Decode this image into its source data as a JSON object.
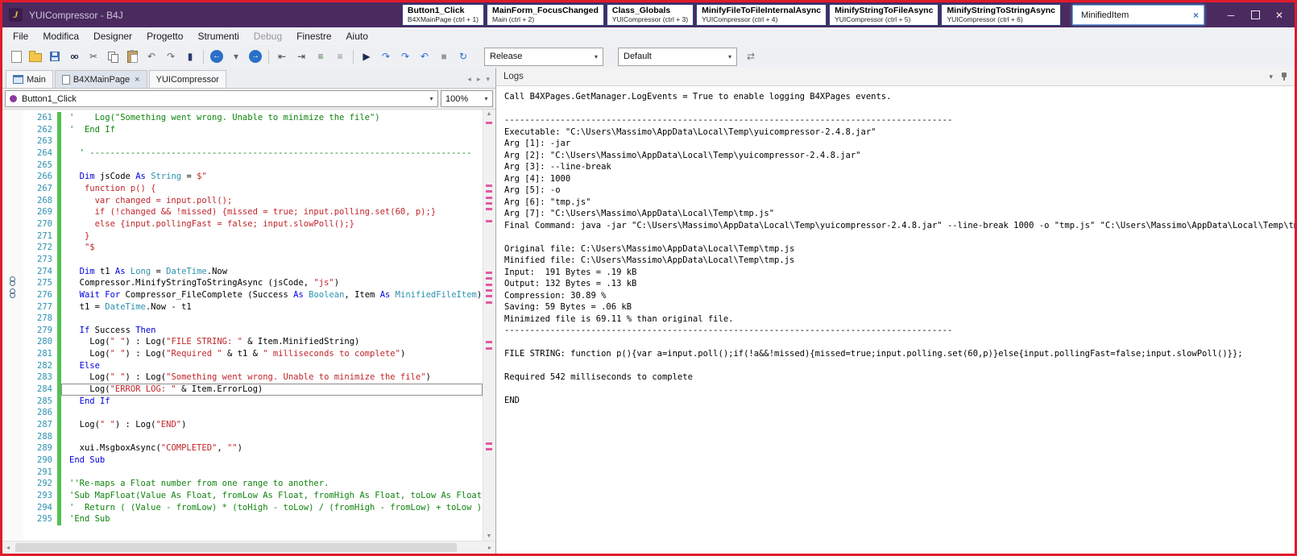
{
  "window": {
    "title": "YUICompressor - B4J",
    "logo": "J",
    "search": {
      "value": "MinifiedItem",
      "clear": "×"
    }
  },
  "quick_tabs": [
    {
      "title": "Button1_Click",
      "subtitle": "B4XMainPage (ctrl + 1)"
    },
    {
      "title": "MainForm_FocusChanged",
      "subtitle": "Main (ctrl + 2)"
    },
    {
      "title": "Class_Globals",
      "subtitle": "YUICompressor (ctrl + 3)"
    },
    {
      "title": "MinifyFileToFileInternalAsync",
      "subtitle": "YUICompressor (ctrl + 4)"
    },
    {
      "title": "MinifyStringToFileAsync",
      "subtitle": "YUICompressor (ctrl + 5)"
    },
    {
      "title": "MinifyStringToStringAsync",
      "subtitle": "YUICompressor (ctrl + 6)"
    }
  ],
  "menu": {
    "items": [
      {
        "label": "File"
      },
      {
        "label": "Modifica"
      },
      {
        "label": "Designer"
      },
      {
        "label": "Progetto"
      },
      {
        "label": "Strumenti"
      },
      {
        "label": "Debug",
        "muted": true
      },
      {
        "label": "Finestre"
      },
      {
        "label": "Aiuto"
      }
    ]
  },
  "toolbar": {
    "build_config": "Release",
    "run_config": "Default",
    "icons": [
      {
        "name": "new-file",
        "cls": "ic-page"
      },
      {
        "name": "open-project",
        "cls": "ic-folder"
      },
      {
        "name": "save",
        "cls": "ic-floppy"
      },
      {
        "name": "find",
        "cls": "ic-find",
        "glyph": "oo"
      },
      {
        "name": "cut",
        "glyph": "✂",
        "color": "#555"
      },
      {
        "name": "copy",
        "cls": "ic-copy"
      },
      {
        "name": "paste",
        "cls": "ic-paste"
      },
      {
        "name": "undo",
        "glyph": "↶",
        "color": "#666"
      },
      {
        "name": "redo",
        "glyph": "↷",
        "color": "#666"
      },
      {
        "name": "bookmark",
        "glyph": "▮",
        "color": "#2d3a6b"
      },
      {
        "sep": true
      },
      {
        "name": "navigate-back",
        "cls": "ic-circle",
        "glyph": "←"
      },
      {
        "name": "back-history-dropdown",
        "glyph": "▾",
        "color": "#666"
      },
      {
        "name": "navigate-forward",
        "cls": "ic-circle",
        "glyph": "→"
      },
      {
        "sep": true
      },
      {
        "name": "outdent",
        "glyph": "⇤",
        "color": "#444"
      },
      {
        "name": "indent",
        "glyph": "⇥",
        "color": "#444"
      },
      {
        "name": "comment",
        "glyph": "≡",
        "color": "#3a7a3a"
      },
      {
        "name": "uncomment",
        "glyph": "≡",
        "color": "#888"
      },
      {
        "sep": true
      },
      {
        "name": "run",
        "glyph": "▶",
        "color": "#1b2a4a"
      },
      {
        "name": "step-over",
        "glyph": "↷",
        "color": "#2b6cd4"
      },
      {
        "name": "step-into",
        "glyph": "↷",
        "color": "#2b6cd4"
      },
      {
        "name": "step-out",
        "glyph": "↶",
        "color": "#2b6cd4"
      },
      {
        "name": "stop",
        "glyph": "■",
        "color": "#9a9a9a"
      },
      {
        "name": "resume",
        "glyph": "↻",
        "color": "#2b6cd4"
      }
    ],
    "config_switch_glyph": "⇄"
  },
  "doc_tabs": {
    "tabs": [
      {
        "label": "Main",
        "icon": "form"
      },
      {
        "label": "B4XMainPage",
        "icon": "page",
        "active": true,
        "close": "×"
      },
      {
        "label": "YUICompressor"
      }
    ]
  },
  "module_selector": {
    "value": "Button1_Click"
  },
  "zoom": {
    "value": "100%"
  },
  "editor": {
    "current_line": 284,
    "scroll_markers": [
      15,
      93,
      100,
      108,
      115,
      122,
      137,
      201,
      208,
      216,
      223,
      230,
      238,
      287,
      295,
      413,
      420
    ],
    "lines": [
      {
        "n": 261,
        "segs": [
          [
            "c",
            "'    Log(\"Something went wrong. Unable to minimize the file\")"
          ]
        ]
      },
      {
        "n": 262,
        "segs": [
          [
            "c",
            "'  End If"
          ]
        ]
      },
      {
        "n": 263,
        "segs": []
      },
      {
        "n": 264,
        "segs": [
          [
            "c",
            "  ' ---------------------------------------------------------------------------"
          ]
        ]
      },
      {
        "n": 265,
        "segs": []
      },
      {
        "n": 266,
        "segs": [
          [
            "",
            "  "
          ],
          [
            "k",
            "Dim"
          ],
          [
            "",
            " jsCode "
          ],
          [
            "k",
            "As"
          ],
          [
            "",
            " "
          ],
          [
            "t",
            "String"
          ],
          [
            "",
            " = "
          ],
          [
            "s",
            "$\""
          ]
        ]
      },
      {
        "n": 267,
        "segs": [
          [
            "s",
            "   function p() {"
          ]
        ]
      },
      {
        "n": 268,
        "segs": [
          [
            "s",
            "     var changed = input.poll();"
          ]
        ]
      },
      {
        "n": 269,
        "segs": [
          [
            "s",
            "     if (!changed && !missed) {missed = true; input.polling.set(60, p);}"
          ]
        ]
      },
      {
        "n": 270,
        "segs": [
          [
            "s",
            "     else {input.pollingFast = false; input.slowPoll();}"
          ]
        ]
      },
      {
        "n": 271,
        "segs": [
          [
            "s",
            "   }"
          ]
        ]
      },
      {
        "n": 272,
        "segs": [
          [
            "s",
            "   \"$"
          ]
        ]
      },
      {
        "n": 273,
        "segs": []
      },
      {
        "n": 274,
        "segs": [
          [
            "",
            "  "
          ],
          [
            "k",
            "Dim"
          ],
          [
            "",
            " t1 "
          ],
          [
            "k",
            "As"
          ],
          [
            "",
            " "
          ],
          [
            "t",
            "Long"
          ],
          [
            "",
            " = "
          ],
          [
            "t",
            "DateTime"
          ],
          [
            "",
            ".Now"
          ]
        ]
      },
      {
        "n": 275,
        "segs": [
          [
            "",
            "  Compressor.MinifyStringToStringAsync (jsCode, "
          ],
          [
            "s",
            "\"js\""
          ],
          [
            "",
            ")"
          ]
        ]
      },
      {
        "n": 276,
        "segs": [
          [
            "",
            "  "
          ],
          [
            "k",
            "Wait For"
          ],
          [
            "",
            " Compressor_FileComplete (Success "
          ],
          [
            "k",
            "As"
          ],
          [
            "",
            " "
          ],
          [
            "t",
            "Boolean"
          ],
          [
            "",
            ", Item "
          ],
          [
            "k",
            "As"
          ],
          [
            "",
            " "
          ],
          [
            "t",
            "MinifiedFileItem"
          ],
          [
            "",
            ")"
          ]
        ]
      },
      {
        "n": 277,
        "segs": [
          [
            "",
            "  t1 = "
          ],
          [
            "t",
            "DateTime"
          ],
          [
            "",
            ".Now - t1"
          ]
        ]
      },
      {
        "n": 278,
        "segs": []
      },
      {
        "n": 279,
        "segs": [
          [
            "",
            "  "
          ],
          [
            "k",
            "If"
          ],
          [
            "",
            " Success "
          ],
          [
            "k",
            "Then"
          ]
        ]
      },
      {
        "n": 280,
        "segs": [
          [
            "",
            "    Log("
          ],
          [
            "s",
            "\" \""
          ],
          [
            "",
            ") : Log("
          ],
          [
            "s",
            "\"FILE STRING: \""
          ],
          [
            "",
            " & Item.MinifiedString)"
          ]
        ]
      },
      {
        "n": 281,
        "segs": [
          [
            "",
            "    Log("
          ],
          [
            "s",
            "\" \""
          ],
          [
            "",
            ") : Log("
          ],
          [
            "s",
            "\"Required \""
          ],
          [
            "",
            " & t1 & "
          ],
          [
            "s",
            "\" milliseconds to complete\""
          ],
          [
            "",
            ")"
          ]
        ]
      },
      {
        "n": 282,
        "segs": [
          [
            "",
            "  "
          ],
          [
            "k",
            "Else"
          ]
        ]
      },
      {
        "n": 283,
        "segs": [
          [
            "",
            "    Log("
          ],
          [
            "s",
            "\" \""
          ],
          [
            "",
            ") : Log("
          ],
          [
            "s",
            "\"Something went wrong. Unable to minimize the file\""
          ],
          [
            "",
            ")"
          ]
        ]
      },
      {
        "n": 284,
        "segs": [
          [
            "",
            "    Log("
          ],
          [
            "s",
            "\"ERROR LOG: \""
          ],
          [
            "",
            " & Item.ErrorLog)"
          ]
        ]
      },
      {
        "n": 285,
        "segs": [
          [
            "",
            "  "
          ],
          [
            "k",
            "End If"
          ]
        ]
      },
      {
        "n": 286,
        "segs": []
      },
      {
        "n": 287,
        "segs": [
          [
            "",
            "  Log("
          ],
          [
            "s",
            "\" \""
          ],
          [
            "",
            ") : Log("
          ],
          [
            "s",
            "\"END\""
          ],
          [
            "",
            ")"
          ]
        ]
      },
      {
        "n": 288,
        "segs": []
      },
      {
        "n": 289,
        "segs": [
          [
            "",
            "  xui.MsgboxAsync("
          ],
          [
            "s",
            "\"COMPLETED\""
          ],
          [
            "",
            ", "
          ],
          [
            "s",
            "\"\""
          ],
          [
            "",
            ")"
          ]
        ]
      },
      {
        "n": 290,
        "segs": [
          [
            "k",
            "End Sub"
          ]
        ]
      },
      {
        "n": 291,
        "segs": []
      },
      {
        "n": 292,
        "segs": [
          [
            "c",
            "''Re-maps a Float number from one range to another."
          ]
        ]
      },
      {
        "n": 293,
        "segs": [
          [
            "c",
            "'Sub MapFloat(Value As Float, fromLow As Float, fromHigh As Float, toLow As Float, t"
          ]
        ]
      },
      {
        "n": 294,
        "segs": [
          [
            "c",
            "'  Return ( (Value - fromLow) * (toHigh - toLow) / (fromHigh - fromLow) + toLow )"
          ]
        ]
      },
      {
        "n": 295,
        "segs": [
          [
            "c",
            "'End Sub"
          ]
        ]
      }
    ]
  },
  "logs": {
    "title": "Logs",
    "lines": [
      "Call B4XPages.GetManager.LogEvents = True to enable logging B4XPages events.",
      "",
      "----------------------------------------------------------------------------------------",
      "Executable: \"C:\\Users\\Massimo\\AppData\\Local\\Temp\\yuicompressor-2.4.8.jar\"",
      "Arg [1]: -jar",
      "Arg [2]: \"C:\\Users\\Massimo\\AppData\\Local\\Temp\\yuicompressor-2.4.8.jar\"",
      "Arg [3]: --line-break",
      "Arg [4]: 1000",
      "Arg [5]: -o",
      "Arg [6]: \"tmp.js\"",
      "Arg [7]: \"C:\\Users\\Massimo\\AppData\\Local\\Temp\\tmp.js\"",
      "Final Command: java -jar \"C:\\Users\\Massimo\\AppData\\Local\\Temp\\yuicompressor-2.4.8.jar\" --line-break 1000 -o \"tmp.js\" \"C:\\Users\\Massimo\\AppData\\Local\\Temp\\tmp.js\"",
      "",
      "Original file: C:\\Users\\Massimo\\AppData\\Local\\Temp\\tmp.js",
      "Minified file: C:\\Users\\Massimo\\AppData\\Local\\Temp\\tmp.js",
      "Input:  191 Bytes = .19 kB",
      "Output: 132 Bytes = .13 kB",
      "Compression: 30.89 %",
      "Saving: 59 Bytes = .06 kB",
      "Minimized file is 69.11 % than original file.",
      "----------------------------------------------------------------------------------------",
      "",
      "FILE STRING: function p(){var a=input.poll();if(!a&&!missed){missed=true;input.polling.set(60,p)}else{input.pollingFast=false;input.slowPoll()}};",
      "",
      "Required 542 milliseconds to complete",
      "",
      "END"
    ]
  }
}
